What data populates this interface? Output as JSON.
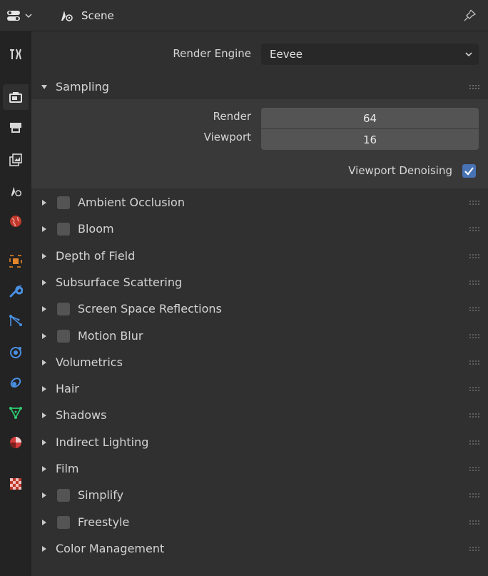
{
  "header": {
    "title": "Scene",
    "editor_icon": "properties-editor-icon",
    "scene_icon": "scene-icon",
    "pin_icon": "pin-icon"
  },
  "tabs": [
    {
      "name": "tool-tab",
      "icon": "tool-icon"
    },
    {
      "name": "render-tab",
      "icon": "render-camera-icon",
      "active": true
    },
    {
      "name": "output-tab",
      "icon": "printer-icon"
    },
    {
      "name": "view-layer-tab",
      "icon": "view-layer-icon"
    },
    {
      "name": "scene-tab",
      "icon": "scene-icon"
    },
    {
      "name": "world-tab",
      "icon": "world-icon"
    },
    {
      "name": "object-tab",
      "icon": "object-icon"
    },
    {
      "name": "modifiers-tab",
      "icon": "wrench-icon"
    },
    {
      "name": "particles-tab",
      "icon": "particles-icon"
    },
    {
      "name": "physics-tab",
      "icon": "physics-icon"
    },
    {
      "name": "constraints-tab",
      "icon": "constraint-icon"
    },
    {
      "name": "data-tab",
      "icon": "mesh-data-icon"
    },
    {
      "name": "material-tab",
      "icon": "material-icon"
    },
    {
      "name": "texture-tab",
      "icon": "texture-icon"
    }
  ],
  "render_engine": {
    "label": "Render Engine",
    "value": "Eevee"
  },
  "sampling": {
    "title": "Sampling",
    "render_label": "Render",
    "render_value": "64",
    "viewport_label": "Viewport",
    "viewport_value": "16",
    "denoise_label": "Viewport Denoising",
    "denoise_checked": true
  },
  "sections": [
    {
      "label": "Ambient Occlusion",
      "checkbox": true
    },
    {
      "label": "Bloom",
      "checkbox": true
    },
    {
      "label": "Depth of Field",
      "checkbox": false
    },
    {
      "label": "Subsurface Scattering",
      "checkbox": false
    },
    {
      "label": "Screen Space Reflections",
      "checkbox": true
    },
    {
      "label": "Motion Blur",
      "checkbox": true
    },
    {
      "label": "Volumetrics",
      "checkbox": false
    },
    {
      "label": "Hair",
      "checkbox": false
    },
    {
      "label": "Shadows",
      "checkbox": false
    },
    {
      "label": "Indirect Lighting",
      "checkbox": false
    },
    {
      "label": "Film",
      "checkbox": false
    },
    {
      "label": "Simplify",
      "checkbox": true
    },
    {
      "label": "Freestyle",
      "checkbox": true
    },
    {
      "label": "Color Management",
      "checkbox": false
    }
  ],
  "colors": {
    "panel": "#303030",
    "accent_checkbox": "#4772b3"
  }
}
